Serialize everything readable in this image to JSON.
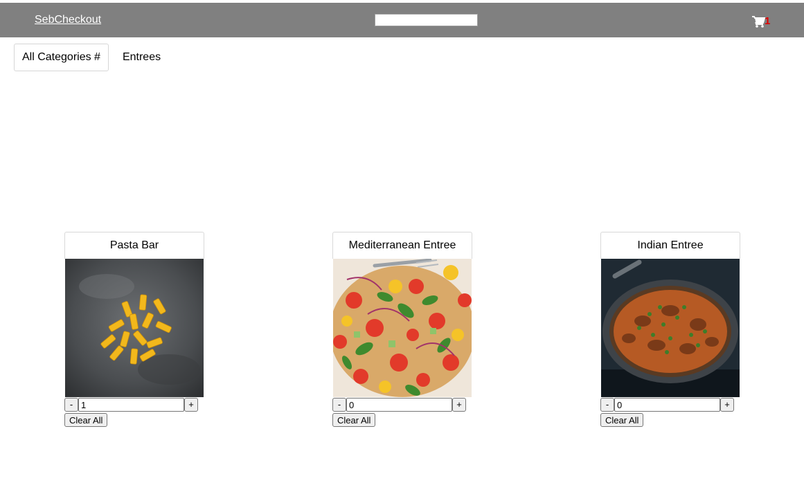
{
  "navbar": {
    "brand": "SebCheckout",
    "search": {
      "value": "",
      "placeholder": ""
    },
    "cart": {
      "icon": "cart-icon",
      "count": "1",
      "count_color": "#e00000"
    },
    "background": "#808080"
  },
  "categories": {
    "all_label": "All Categories #",
    "items": [
      "Entrees"
    ]
  },
  "products": [
    {
      "name": "Pasta Bar",
      "image": "pasta-image",
      "quantity": "1",
      "minus_label": "-",
      "plus_label": "+",
      "clear_label": "Clear All"
    },
    {
      "name": "Mediterranean Entree",
      "image": "mediterranean-salad-image",
      "quantity": "0",
      "minus_label": "-",
      "plus_label": "+",
      "clear_label": "Clear All"
    },
    {
      "name": "Indian Entree",
      "image": "indian-curry-image",
      "quantity": "0",
      "minus_label": "-",
      "plus_label": "+",
      "clear_label": "Clear All"
    }
  ]
}
